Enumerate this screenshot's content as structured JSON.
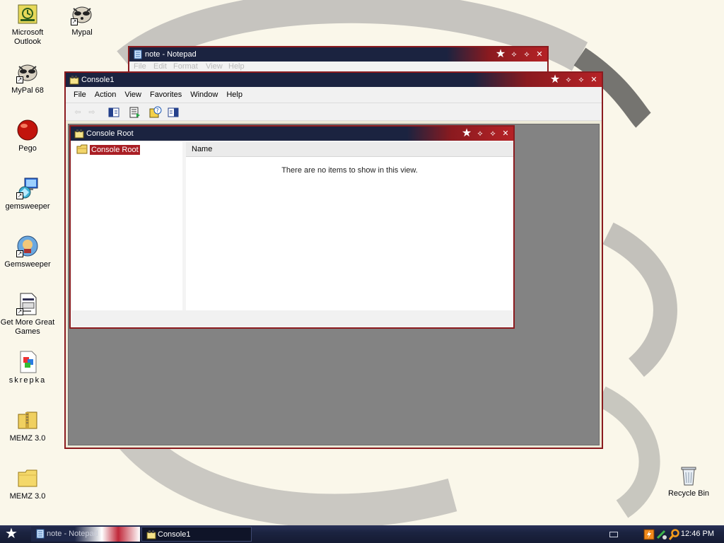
{
  "desktop": {
    "icons": [
      {
        "label": "Microsoft Outlook",
        "line1": "Microsoft",
        "line2": "Outlook",
        "icon": "outlook-icon"
      },
      {
        "label": "Mypal",
        "icon": "raccoon-icon"
      },
      {
        "label": "MyPal 68",
        "icon": "raccoon-icon"
      },
      {
        "label": "Pego",
        "icon": "red-ball-icon"
      },
      {
        "label": "gemsweeper",
        "icon": "computer-gem-icon"
      },
      {
        "label": "Gemsweeper",
        "icon": "gem-icon"
      },
      {
        "label": "Get More Great Games",
        "line1": "Get More Great",
        "line2": "Games",
        "icon": "document-icon"
      },
      {
        "label": "skrepka",
        "icon": "paperclip-icon"
      },
      {
        "label": "MEMZ 3.0",
        "icon": "zip-folder-icon"
      },
      {
        "label": "MEMZ 3.0",
        "icon": "folder-icon"
      },
      {
        "label": "Recycle Bin",
        "icon": "recycle-bin-icon"
      }
    ]
  },
  "notepad": {
    "title": "note - Notepad",
    "menu": [
      "File",
      "Edit",
      "Format",
      "View",
      "Help"
    ]
  },
  "console": {
    "title": "Console1",
    "menu": [
      "File",
      "Action",
      "View",
      "Favorites",
      "Window",
      "Help"
    ],
    "toolbar": [
      "back-icon",
      "forward-icon",
      "show-hide-tree-icon",
      "export-list-icon",
      "help-icon",
      "show-hide-action-pane-icon"
    ],
    "child": {
      "title": "Console Root",
      "tree_root": "Console Root",
      "column_name": "Name",
      "empty_message": "There are no items to show in this view."
    }
  },
  "taskbar": {
    "tasks": [
      {
        "label": "note - Notepad",
        "active": false
      },
      {
        "label": "Console1",
        "active": true
      }
    ],
    "clock": "12:46 PM"
  },
  "colors": {
    "titlebar_dark": "#1b2340",
    "titlebar_red": "#b52226",
    "selection": "#a91e24",
    "mdi_background": "#838383"
  }
}
